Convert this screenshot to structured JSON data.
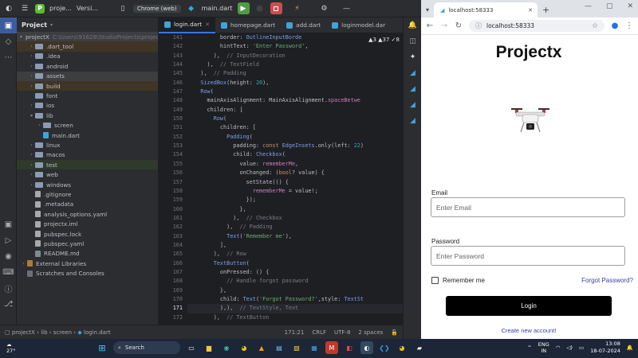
{
  "ide": {
    "project_badge": "P",
    "project_name": "proje...",
    "vcs_label": "Versi...",
    "device": "Chrome (web)",
    "run_config": "main.dart",
    "project_panel_title": "Project"
  },
  "tree": [
    {
      "label": "projectX",
      "suffix": "C:\\Users\\91628\\StudioProjects\\projectX",
      "indent": 0,
      "arrow": "v",
      "kind": "folder",
      "hl": "dark"
    },
    {
      "label": ".dart_tool",
      "indent": 1,
      "arrow": ">",
      "kind": "folder",
      "hl": "orange"
    },
    {
      "label": ".idea",
      "indent": 1,
      "arrow": ">",
      "kind": "folder",
      "hl": ""
    },
    {
      "label": "android",
      "indent": 1,
      "arrow": ">",
      "kind": "folder",
      "hl": ""
    },
    {
      "label": "assets",
      "indent": 1,
      "arrow": ">",
      "kind": "folder",
      "hl": "dark"
    },
    {
      "label": "build",
      "indent": 1,
      "arrow": ">",
      "kind": "folder",
      "hl": "orange"
    },
    {
      "label": "font",
      "indent": 1,
      "arrow": "",
      "kind": "folder",
      "hl": ""
    },
    {
      "label": "ios",
      "indent": 1,
      "arrow": ">",
      "kind": "folder",
      "hl": ""
    },
    {
      "label": "lib",
      "indent": 1,
      "arrow": "v",
      "kind": "folder",
      "hl": ""
    },
    {
      "label": "screen",
      "indent": 2,
      "arrow": ">",
      "kind": "folder",
      "hl": ""
    },
    {
      "label": "main.dart",
      "indent": 2,
      "arrow": "",
      "kind": "dart",
      "hl": ""
    },
    {
      "label": "linux",
      "indent": 1,
      "arrow": ">",
      "kind": "folder",
      "hl": ""
    },
    {
      "label": "macos",
      "indent": 1,
      "arrow": ">",
      "kind": "folder",
      "hl": ""
    },
    {
      "label": "test",
      "indent": 1,
      "arrow": ">",
      "kind": "folder",
      "hl": "green"
    },
    {
      "label": "web",
      "indent": 1,
      "arrow": ">",
      "kind": "folder",
      "hl": ""
    },
    {
      "label": "windows",
      "indent": 1,
      "arrow": ">",
      "kind": "folder",
      "hl": ""
    },
    {
      "label": ".gitignore",
      "indent": 1,
      "arrow": "",
      "kind": "file",
      "hl": ""
    },
    {
      "label": ".metadata",
      "indent": 1,
      "arrow": "",
      "kind": "file",
      "hl": ""
    },
    {
      "label": "analysis_options.yaml",
      "indent": 1,
      "arrow": "",
      "kind": "file",
      "hl": ""
    },
    {
      "label": "projectx.iml",
      "indent": 1,
      "arrow": "",
      "kind": "file",
      "hl": ""
    },
    {
      "label": "pubspec.lock",
      "indent": 1,
      "arrow": "",
      "kind": "file",
      "hl": ""
    },
    {
      "label": "pubspec.yaml",
      "indent": 1,
      "arrow": "",
      "kind": "file",
      "hl": ""
    },
    {
      "label": "README.md",
      "indent": 1,
      "arrow": "",
      "kind": "md",
      "hl": ""
    },
    {
      "label": "External Libraries",
      "indent": 0,
      "arrow": ">",
      "kind": "lib",
      "hl": ""
    },
    {
      "label": "Scratches and Consoles",
      "indent": 0,
      "arrow": "",
      "kind": "scratch",
      "hl": ""
    }
  ],
  "tabs": [
    {
      "label": "login.dart",
      "active": true
    },
    {
      "label": "homepage.dart",
      "active": false
    },
    {
      "label": "add.dart",
      "active": false
    },
    {
      "label": "loginmodel.dar",
      "active": false
    }
  ],
  "inspections": "▲3  ▲37  ✓8",
  "code_lines": [
    {
      "n": "141",
      "html": "          border: <span class='t'>OutlineInputBorde</span>"
    },
    {
      "n": "142",
      "html": "          hintText: <span class='s'>'Enter Password'</span>,"
    },
    {
      "n": "143",
      "html": "        ),  <span class='c'>// InputDecoration</span>"
    },
    {
      "n": "144",
      "html": "      ),  <span class='c'>// TextField</span>"
    },
    {
      "n": "145",
      "html": "    ),  <span class='c'>// Padding</span>"
    },
    {
      "n": "146",
      "html": "    <span class='t'>SizedBox</span>(height: <span class='n'>20</span>),"
    },
    {
      "n": "147",
      "html": "    <span class='t'>Row</span>("
    },
    {
      "n": "148",
      "html": "      mainAxisAlignment: MainAxisAlignment.<span class='p'>spaceBetwe</span>"
    },
    {
      "n": "149",
      "html": "      children: ["
    },
    {
      "n": "150",
      "html": "        <span class='t'>Row</span>("
    },
    {
      "n": "151",
      "html": "          children: ["
    },
    {
      "n": "152",
      "html": "            <span class='t'>Padding</span>("
    },
    {
      "n": "153",
      "html": "              padding: <span class='k'>const</span> <span class='t'>EdgeInsets</span>.only(left: <span class='n'>22</span>)"
    },
    {
      "n": "154",
      "html": "              child: <span class='t'>Checkbox</span>("
    },
    {
      "n": "155",
      "html": "                value: <span class='p'>rememberMe</span>,"
    },
    {
      "n": "156",
      "html": "                onChanged: (<span class='k'>bool</span>? value) {"
    },
    {
      "n": "157",
      "html": "                  setState(() {"
    },
    {
      "n": "158",
      "html": "                    <span class='p'>rememberMe</span> = value!;"
    },
    {
      "n": "159",
      "html": "                  });"
    },
    {
      "n": "160",
      "html": "                },"
    },
    {
      "n": "161",
      "html": "              ),  <span class='c'>// Checkbox</span>"
    },
    {
      "n": "162",
      "html": "            ),  <span class='c'>// Padding</span>"
    },
    {
      "n": "163",
      "html": "            <span class='t'>Text</span>(<span class='s'>'Remember me'</span>),"
    },
    {
      "n": "164",
      "html": "          ],"
    },
    {
      "n": "165",
      "html": "        ),  <span class='c'>// Row</span>"
    },
    {
      "n": "166",
      "html": "        <span class='t'>TextButton</span>("
    },
    {
      "n": "167",
      "html": "          onPressed: () {"
    },
    {
      "n": "168",
      "html": "            <span class='c'>// Handle forgot password</span>"
    },
    {
      "n": "169",
      "html": "          },"
    },
    {
      "n": "170",
      "html": "          child: <span class='t'>Text</span>(<span class='s'>'Forgot Password?'</span>,style: <span class='t'>TextSt</span>"
    },
    {
      "n": "171",
      "html": "          ),),  <span class='c'>// TextStyle, Text</span>",
      "cur": true
    },
    {
      "n": "172",
      "html": "        ),  <span class='c'>// TextButton</span>"
    }
  ],
  "status": {
    "breadcrumb": [
      "projectX",
      "lib",
      "screen",
      "login.dart"
    ],
    "position": "171:21",
    "line_sep": "CRLF",
    "encoding": "UTF-8",
    "indent": "2 spaces"
  },
  "browser": {
    "tab_title": "localhost:58333",
    "url": "localhost:58333"
  },
  "app": {
    "title": "Projectx",
    "email_label": "Email",
    "email_placeholder": "Enter Email",
    "password_label": "Password",
    "password_placeholder": "Enter Password",
    "remember_label": "Remember me",
    "forgot_label": "Forgot Password?",
    "login_label": "Login",
    "create_label": "Create new account!"
  },
  "taskbar": {
    "temp": "27°",
    "search_placeholder": "Search",
    "lang": "ENG",
    "region": "IN",
    "time": "13:08",
    "date": "18-07-2024"
  },
  "colors": {
    "run": "#4f9d43",
    "stop": "#c94f4f",
    "accent": "#3574f0",
    "login_bg": "#000000",
    "link": "#3b3ea8"
  }
}
